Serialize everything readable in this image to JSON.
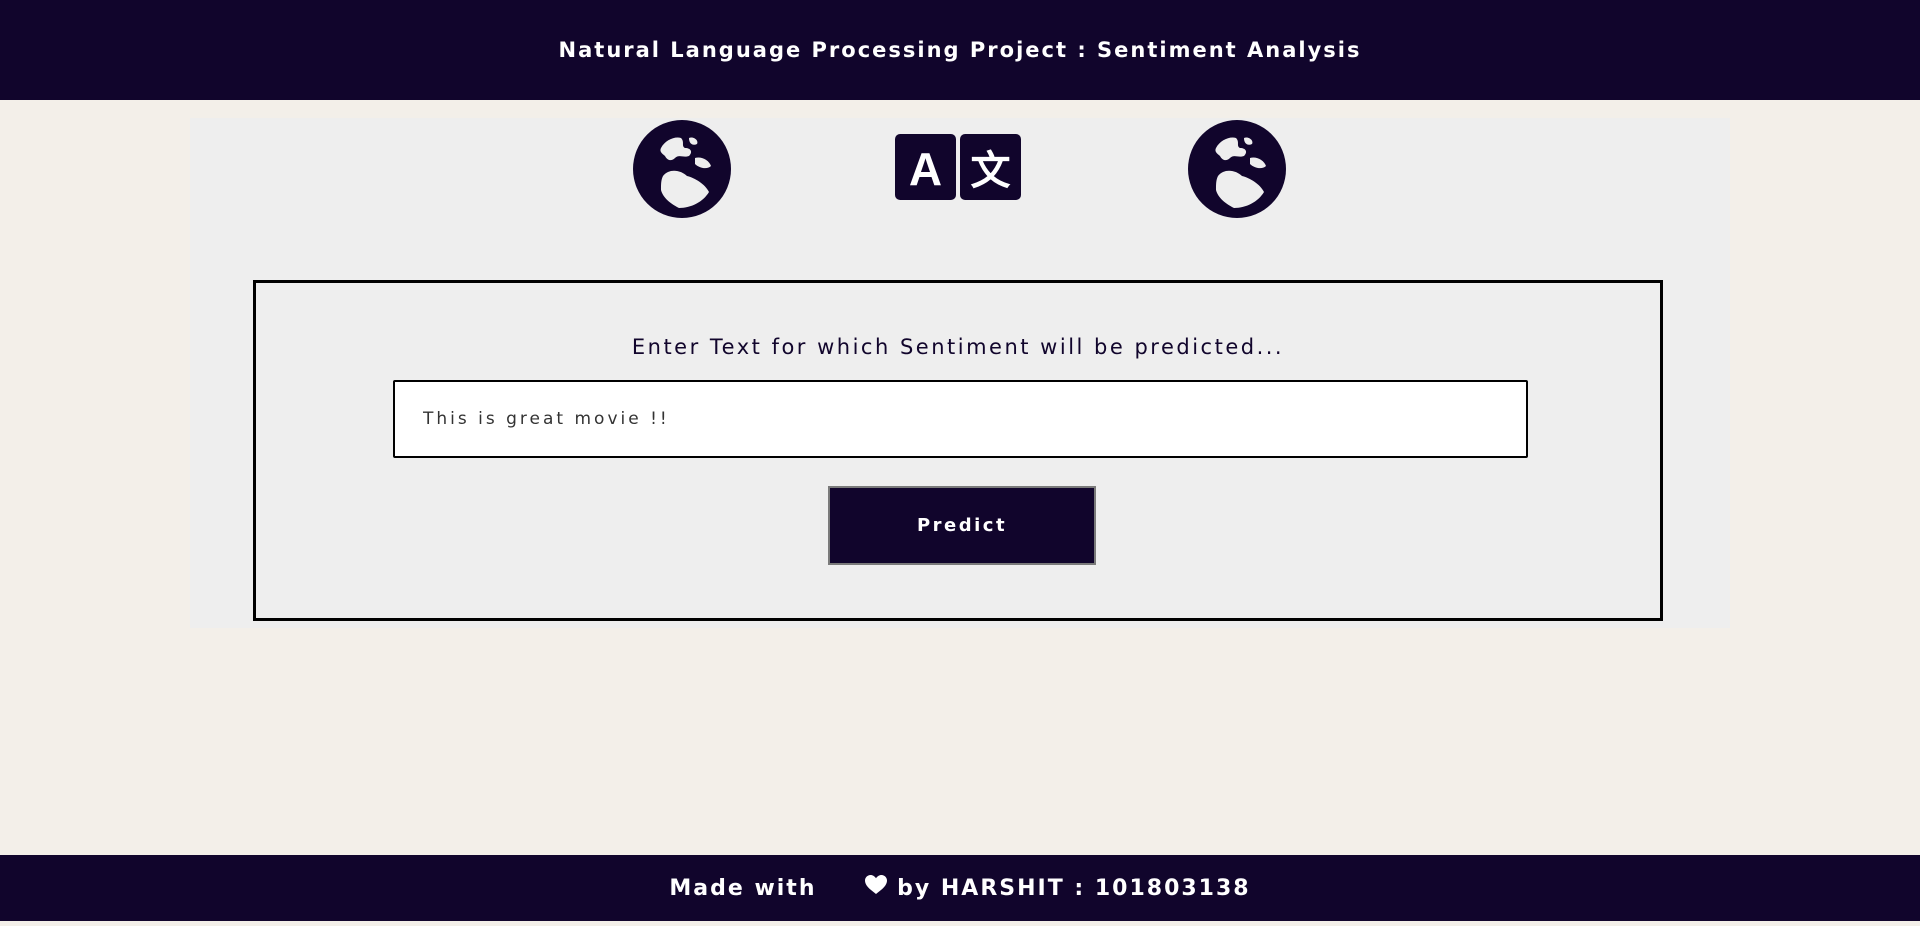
{
  "header": {
    "title": "Natural Language Processing Project : Sentiment Analysis"
  },
  "icons": {
    "left": "globe-icon",
    "center": "translate-icon",
    "right": "globe-icon",
    "translate_latin": "A",
    "translate_cjk": "文"
  },
  "form": {
    "prompt": "Enter Text for which Sentiment will be predicted...",
    "input_value": "This is great movie !!",
    "predict_label": "Predict"
  },
  "footer": {
    "made_with": "Made with",
    "by_text": "by HARSHIT : 101803138",
    "heart_icon": "heart-icon"
  },
  "colors": {
    "primary": "#11052c",
    "background": "#f3efe9",
    "panel": "#eeeeee",
    "white": "#ffffff"
  }
}
